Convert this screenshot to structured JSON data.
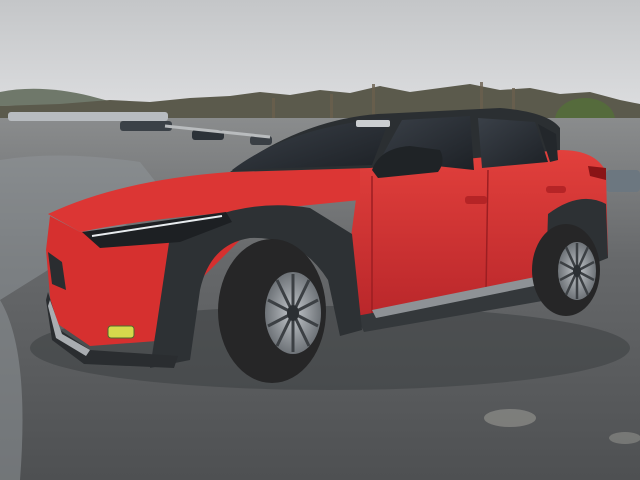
{
  "scene": {
    "subject": "red-compact-electric-suv",
    "setting": "wet-asphalt-parking-lot",
    "colors": {
      "sky": "#cfd1d3",
      "asphalt": "#5f6163",
      "puddle": "#8c9195",
      "tree_line": "#5a5a4e",
      "body_red": "#d9302f",
      "body_red_shadow": "#a51f22",
      "cladding": "#2f3233",
      "glass": "#2a2e33",
      "tire": "#2a2a2a",
      "rim": "#9ea3a8"
    }
  }
}
